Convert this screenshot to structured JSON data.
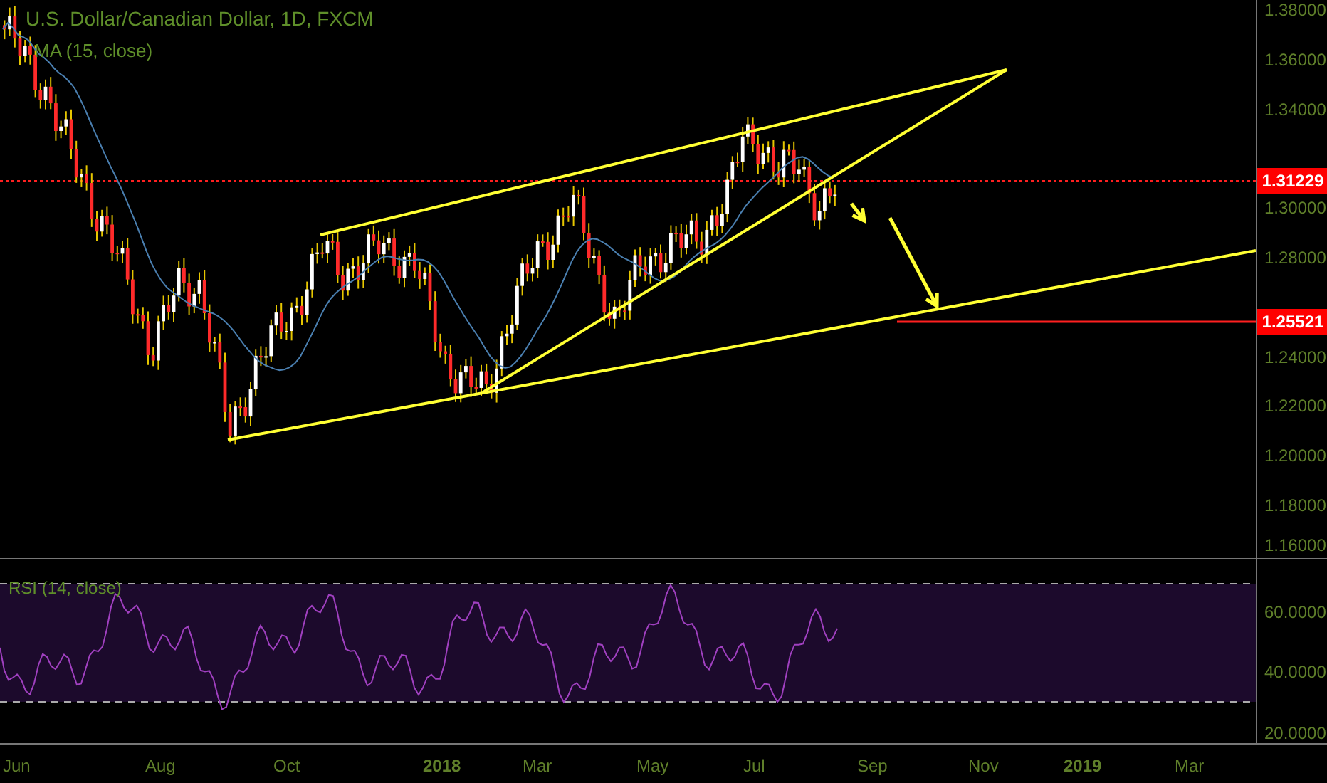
{
  "title": "U.S. Dollar/Canadian Dollar, 1D, FXCM",
  "indicator": "MA (15, close)",
  "price_axis": [
    "1.38000",
    "1.36000",
    "1.34000",
    "1.30000",
    "1.28000",
    "1.24000",
    "1.22000",
    "1.20000",
    "1.18000",
    "1.16000"
  ],
  "price_tags": [
    {
      "label": "1.31229",
      "color": "#ff0000"
    },
    {
      "label": "1.25521",
      "color": "#ff0000"
    }
  ],
  "rsi": {
    "label": "RSI (14, close)",
    "axis": [
      "60.0000",
      "40.0000",
      "20.0000"
    ]
  },
  "time_axis": [
    {
      "label": "Jun",
      "bold": false
    },
    {
      "label": "Aug",
      "bold": false
    },
    {
      "label": "Oct",
      "bold": false
    },
    {
      "label": "2018",
      "bold": true
    },
    {
      "label": "Mar",
      "bold": false
    },
    {
      "label": "May",
      "bold": false
    },
    {
      "label": "Jul",
      "bold": false
    },
    {
      "label": "Sep",
      "bold": false
    },
    {
      "label": "Nov",
      "bold": false
    },
    {
      "label": "2019",
      "bold": true
    },
    {
      "label": "Mar",
      "bold": false
    }
  ]
}
